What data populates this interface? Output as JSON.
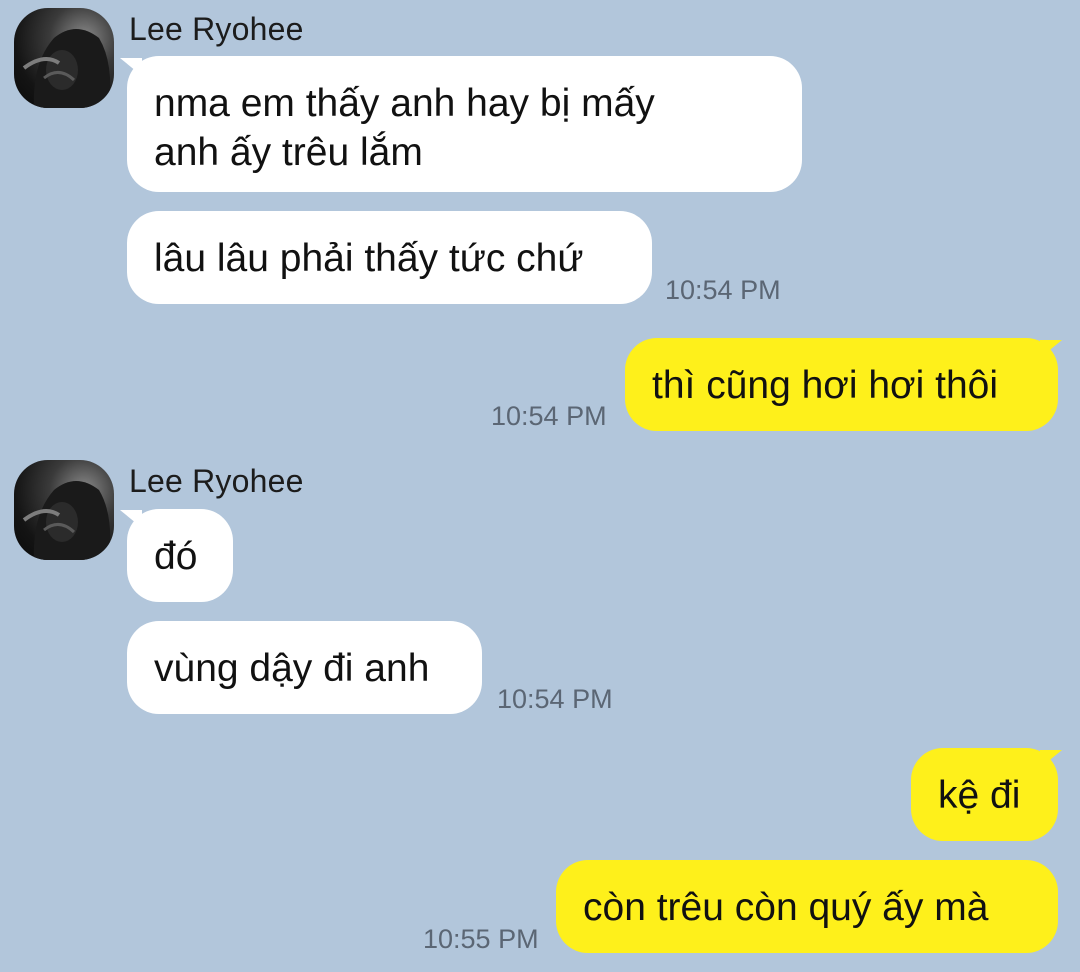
{
  "colors": {
    "background": "#b2c6db",
    "incoming_bubble": "#ffffff",
    "outgoing_bubble": "#fef01b",
    "timestamp": "#5b6674"
  },
  "messages": [
    {
      "sender": "Lee Ryohee",
      "text": "nma em thấy anh hay bị mấy\nanh ấy trêu lắm"
    },
    {
      "text": "lâu lâu phải thấy tức chứ",
      "time": "10:54 PM"
    },
    {
      "text": "thì cũng hơi hơi thôi",
      "time": "10:54 PM"
    },
    {
      "sender": "Lee Ryohee",
      "text": "đó"
    },
    {
      "text": "vùng dậy đi anh",
      "time": "10:54 PM"
    },
    {
      "text": "kệ đi"
    },
    {
      "text": "còn trêu còn quý ấy mà",
      "time": "10:55 PM"
    }
  ],
  "icons": {
    "avatar": "avatar-icon"
  }
}
